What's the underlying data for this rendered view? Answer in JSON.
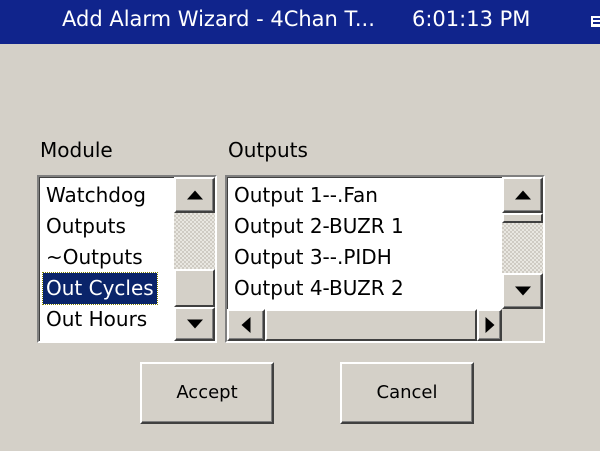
{
  "window": {
    "title": "Add Alarm Wizard - 4Chan T...",
    "clock": "6:01:13 PM"
  },
  "module": {
    "label": "Module",
    "items": [
      "Watchdog",
      "Outputs",
      "~Outputs",
      "Out Cycles",
      "Out Hours"
    ],
    "selected": "Out Cycles"
  },
  "outputs": {
    "label": "Outputs",
    "items": [
      "Output 1--.Fan",
      "Output 2-BUZR 1",
      "Output 3--.PIDH",
      "Output 4-BUZR 2"
    ]
  },
  "buttons": {
    "accept": "Accept",
    "cancel": "Cancel"
  },
  "icons": {
    "tray": "tray-icon",
    "scroll_up": "triangle-up-icon",
    "scroll_down": "triangle-down-icon",
    "scroll_left": "triangle-left-icon",
    "scroll_right": "triangle-right-icon"
  },
  "colors": {
    "titlebar": "#10248c",
    "selection": "#0a246a",
    "face": "#d4d0c8"
  }
}
